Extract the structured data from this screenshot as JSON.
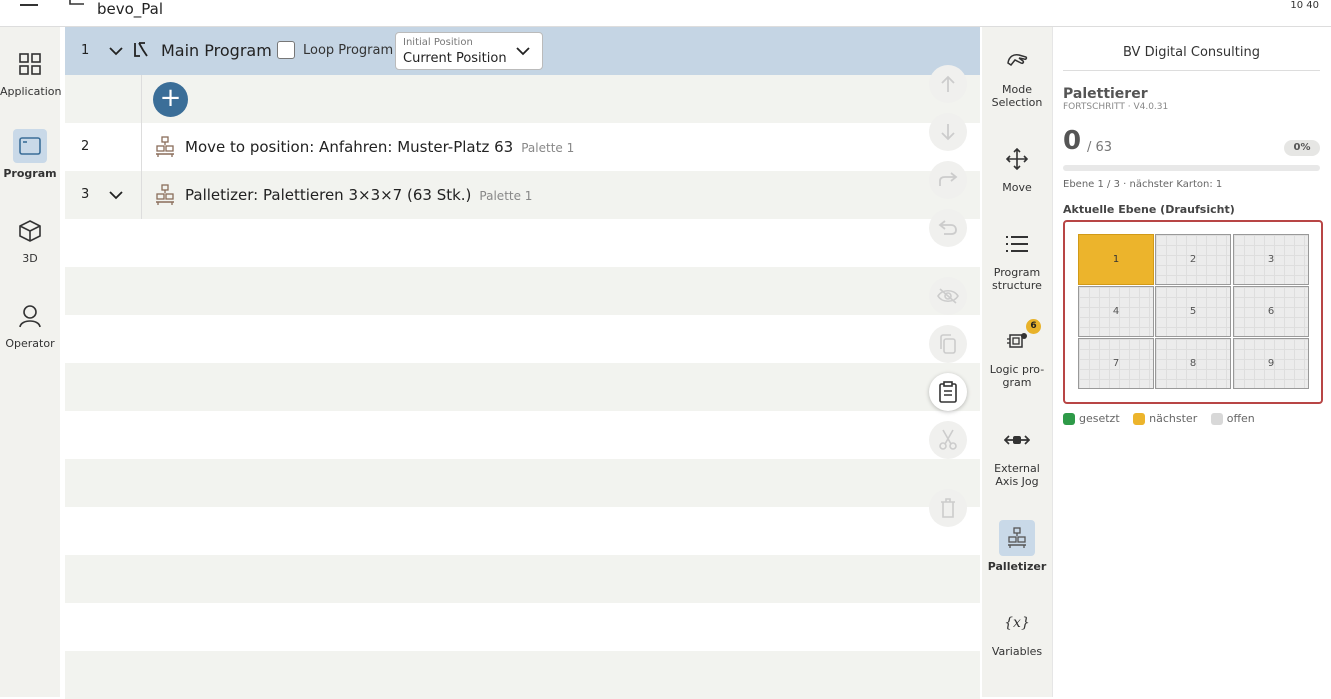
{
  "topbar": {
    "title": "bevo_Pal",
    "clock": "10 40"
  },
  "leftnav": {
    "items": [
      {
        "label": "Application",
        "icon": "grid-icon"
      },
      {
        "label": "Program",
        "icon": "window-icon"
      },
      {
        "label": "3D",
        "icon": "cube-icon"
      },
      {
        "label": "Operator",
        "icon": "user-icon"
      }
    ]
  },
  "program": {
    "main": {
      "number": "1",
      "title": "Main Program",
      "loop_label": "Loop Program",
      "initpos_label": "Initial Position",
      "initpos_value": "Current Position"
    },
    "steps": [
      {
        "number": "2",
        "title": "Move to position:  Anfahren: Muster-Platz 63",
        "tag": "Palette 1"
      },
      {
        "number": "3",
        "title": "Palletizer:  Palettieren 3×3×7 (63 Stk.)",
        "tag": "Palette 1"
      }
    ]
  },
  "rightnav": {
    "items": [
      {
        "label": "Mode Selection",
        "icon": "mode-icon"
      },
      {
        "label": "Move",
        "icon": "move-arrows-icon"
      },
      {
        "label": "Program structure",
        "icon": "list-icon"
      },
      {
        "label": "Logic pro- gram",
        "icon": "logic-icon",
        "badge": "6"
      },
      {
        "label": "External Axis Jog",
        "icon": "axis-icon"
      },
      {
        "label": "Palletizer",
        "icon": "palletizer-icon"
      },
      {
        "label": "Variables",
        "icon": "variables-icon",
        "glyph": "{x}"
      }
    ]
  },
  "panel": {
    "company": "BV Digital Consulting",
    "title": "Palettierer",
    "version": "FORTSCHRITT · V4.0.31",
    "count": "0",
    "total": "/ 63",
    "percent": "0%",
    "progress": 0,
    "status": "Ebene 1 / 3 · nächster Karton: 1",
    "layer_title": "Aktuelle Ebene (Draufsicht)",
    "cells": [
      "1",
      "2",
      "3",
      "4",
      "5",
      "6",
      "7",
      "8",
      "9"
    ],
    "legend": {
      "set": "gesetzt",
      "next": "nächster",
      "open": "offen"
    },
    "colors": {
      "set": "#2e9a48",
      "next": "#ecb42c",
      "open": "#d8d8d8"
    }
  }
}
